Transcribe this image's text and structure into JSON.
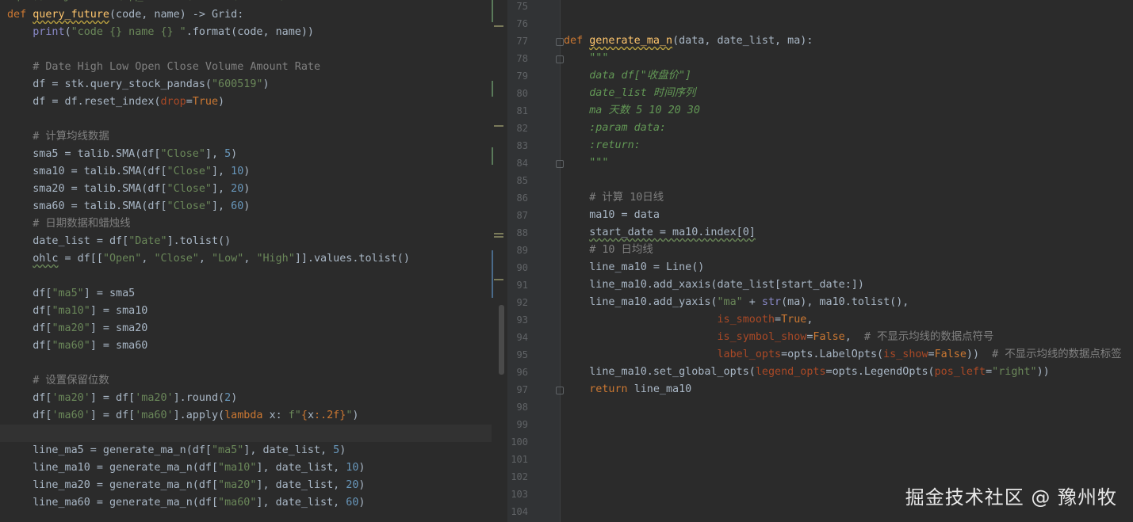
{
  "left_lines": [
    [
      "def",
      "query_future",
      "(code, name) -> Grid:"
    ],
    [
      "    print(\"code {} name {} \".format(code, name))"
    ],
    [
      ""
    ],
    [
      "    # Date High Low Open Close Volume Amount Rate"
    ],
    [
      "    df = stk.query_stock_pandas(\"600519\")"
    ],
    [
      "    df = df.reset_index(drop=True)"
    ],
    [
      ""
    ],
    [
      "    # 计算均线数据"
    ],
    [
      "    sma5 = talib.SMA(df[\"Close\"], 5)"
    ],
    [
      "    sma10 = talib.SMA(df[\"Close\"], 10)"
    ],
    [
      "    sma20 = talib.SMA(df[\"Close\"], 20)"
    ],
    [
      "    sma60 = talib.SMA(df[\"Close\"], 60)"
    ],
    [
      "    # 日期数据和蜡烛线"
    ],
    [
      "    date_list = df[\"Date\"].tolist()"
    ],
    [
      "    ohlc = df[[\"Open\", \"Close\", \"Low\", \"High\"]].values.tolist()"
    ],
    [
      ""
    ],
    [
      "    df[\"ma5\"] = sma5"
    ],
    [
      "    df[\"ma10\"] = sma10"
    ],
    [
      "    df[\"ma20\"] = sma20"
    ],
    [
      "    df[\"ma60\"] = sma60"
    ],
    [
      ""
    ],
    [
      "    # 设置保留位数"
    ],
    [
      "    df['ma20'] = df['ma20'].round(2)"
    ],
    [
      "    df['ma60'] = df['ma60'].apply(lambda x: f\"{x:.2f}\")"
    ],
    [
      ""
    ],
    [
      "    line_ma5 = generate_ma_n(df[\"ma5\"], date_list, 5)"
    ],
    [
      "    line_ma10 = generate_ma_n(df[\"ma10\"], date_list, 10)"
    ],
    [
      "    line_ma20 = generate_ma_n(df[\"ma20\"], date_list, 20)"
    ],
    [
      "    line_ma60 = generate_ma_n(df[\"ma60\"], date_list, 60)"
    ]
  ],
  "right_line_numbers": [
    "75",
    "76",
    "77",
    "78",
    "79",
    "80",
    "81",
    "82",
    "83",
    "84",
    "85",
    "86",
    "87",
    "88",
    "89",
    "90",
    "91",
    "92",
    "93",
    "94",
    "95",
    "96",
    "97",
    "98",
    "99",
    "100",
    "101",
    "102",
    "103",
    "104"
  ],
  "watermark": "掘金技术社区 @ 豫州牧"
}
